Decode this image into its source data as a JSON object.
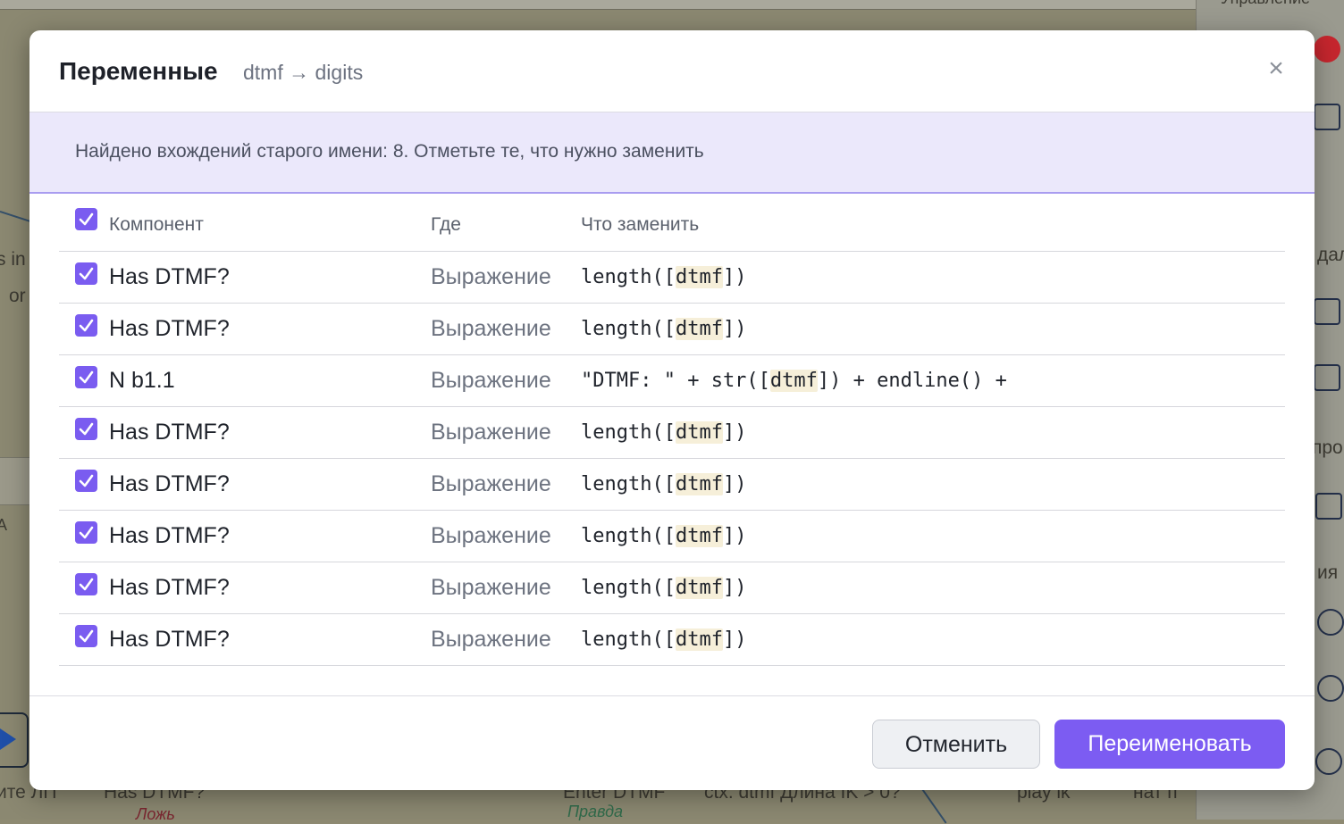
{
  "background": {
    "fragments": [
      "s in",
      "or",
      "A",
      "ите ЛП",
      "Has DTMF?",
      "Ложь",
      "Enter DTMF",
      "Правда",
      "ctx. dtmf Длина IK > 0?",
      "play ik",
      "нат п"
    ],
    "right_panel": [
      "Управление",
      "дал",
      "проб",
      "ия"
    ]
  },
  "dialog": {
    "title": "Переменные",
    "subtitle": "dtmf → digits",
    "close_label": "×",
    "info": "Найдено вхождений старого имени: 8. Отметьте те, что нужно заменить",
    "columns": {
      "component": "Компонент",
      "where": "Где",
      "replace": "Что заменить"
    },
    "select_all_checked": true,
    "rows": [
      {
        "checked": true,
        "component": "Has DTMF?",
        "where": "Выражение",
        "code_before": "length([",
        "code_var": "dtmf",
        "code_after": "])"
      },
      {
        "checked": true,
        "component": "Has DTMF?",
        "where": "Выражение",
        "code_before": "length([",
        "code_var": "dtmf",
        "code_after": "])"
      },
      {
        "checked": true,
        "component": "N b1.1",
        "where": "Выражение",
        "code_before": "\"DTMF: \" + str([",
        "code_var": "dtmf",
        "code_after": "]) + endline() +"
      },
      {
        "checked": true,
        "component": "Has DTMF?",
        "where": "Выражение",
        "code_before": "length([",
        "code_var": "dtmf",
        "code_after": "])"
      },
      {
        "checked": true,
        "component": "Has DTMF?",
        "where": "Выражение",
        "code_before": "length([",
        "code_var": "dtmf",
        "code_after": "])"
      },
      {
        "checked": true,
        "component": "Has DTMF?",
        "where": "Выражение",
        "code_before": "length([",
        "code_var": "dtmf",
        "code_after": "])"
      },
      {
        "checked": true,
        "component": "Has DTMF?",
        "where": "Выражение",
        "code_before": "length([",
        "code_var": "dtmf",
        "code_after": "])"
      },
      {
        "checked": true,
        "component": "Has DTMF?",
        "where": "Выражение",
        "code_before": "length([",
        "code_var": "dtmf",
        "code_after": "])"
      }
    ],
    "buttons": {
      "cancel": "Отменить",
      "confirm": "Переименовать"
    }
  },
  "colors": {
    "accent": "#7c5cf2",
    "info_bg": "#ebe8fb",
    "highlight": "#f6efd9"
  }
}
